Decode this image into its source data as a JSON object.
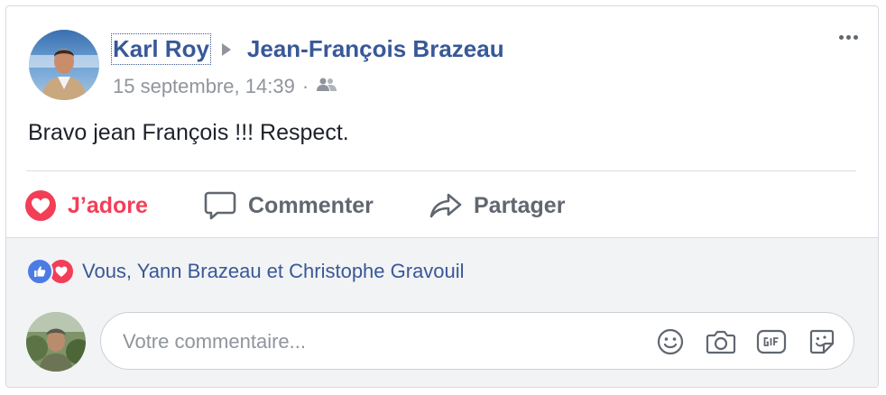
{
  "post": {
    "author": "Karl Roy",
    "target": "Jean-François Brazeau",
    "timestamp": "15 septembre, 14:39",
    "separator": "·",
    "audience_icon": "friends-icon",
    "text": "Bravo jean François !!! Respect."
  },
  "actions": {
    "love": "J’adore",
    "comment": "Commenter",
    "share": "Partager"
  },
  "reactions": {
    "summary": "Vous, Yann Brazeau et Christophe Gravouil",
    "icons": [
      "like-icon",
      "love-icon"
    ]
  },
  "comment_box": {
    "placeholder": "Votre commentaire...",
    "icons": [
      "emoji-icon",
      "camera-icon",
      "gif-icon",
      "sticker-icon"
    ]
  },
  "colors": {
    "link": "#385898",
    "love": "#f33e58",
    "like": "#4b7be5",
    "muted": "#90949c",
    "action": "#606770",
    "footer_bg": "#f2f3f5"
  }
}
